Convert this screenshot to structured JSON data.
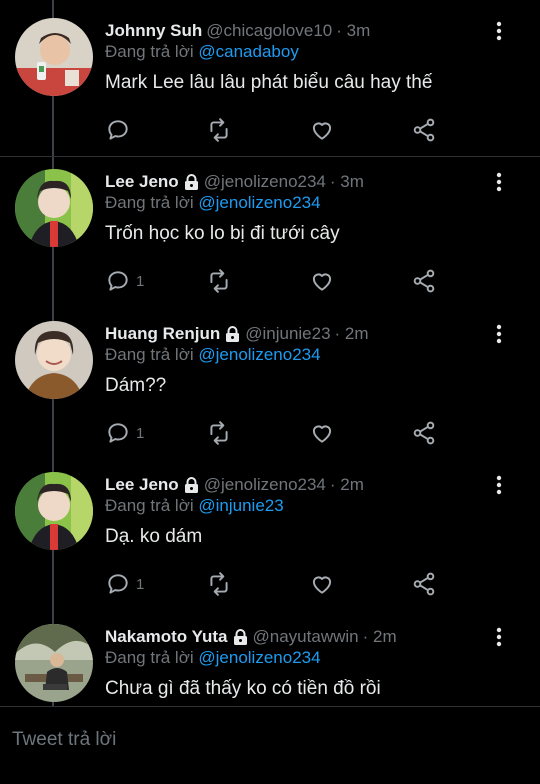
{
  "reply_prefix": "Đang trả lời",
  "tweets": [
    {
      "name": "Johnny Suh",
      "handle": "@chicagolove10",
      "time": "· 3m",
      "locked": false,
      "reply_to": "@canadaboy",
      "text": "Mark Lee lâu lâu phát biểu câu hay thế",
      "replies": ""
    },
    {
      "name": "Lee Jeno",
      "handle": "@jenolizeno234",
      "time": "· 3m",
      "locked": true,
      "reply_to": "@jenolizeno234",
      "text": "Trốn học ko lo bị đi tưới cây",
      "replies": "1"
    },
    {
      "name": "Huang Renjun",
      "handle": "@injunie23",
      "time": "· 2m",
      "locked": true,
      "reply_to": "@jenolizeno234",
      "text": "Dám??",
      "replies": "1"
    },
    {
      "name": "Lee Jeno",
      "handle": "@jenolizeno234",
      "time": "· 2m",
      "locked": true,
      "reply_to": "@injunie23",
      "text": "Dạ. ko dám",
      "replies": "1"
    },
    {
      "name": "Nakamoto Yuta",
      "handle": "@nayutawwin",
      "time": "· 2m",
      "locked": true,
      "reply_to": "@jenolizeno234",
      "text": "Chưa gì đã thấy ko có tiền đồ rồi",
      "replies": ""
    }
  ],
  "composer": {
    "placeholder": "Tweet trả lời"
  },
  "icons": {
    "reply": "reply-icon",
    "retweet": "retweet-icon",
    "like": "heart-icon",
    "share": "share-icon",
    "more": "more-vertical-icon",
    "lock": "lock-icon"
  },
  "colors": {
    "background": "#000000",
    "text": "#e7e9ea",
    "muted": "#71767b",
    "link": "#1d9bf0",
    "divider": "#2f3336"
  }
}
